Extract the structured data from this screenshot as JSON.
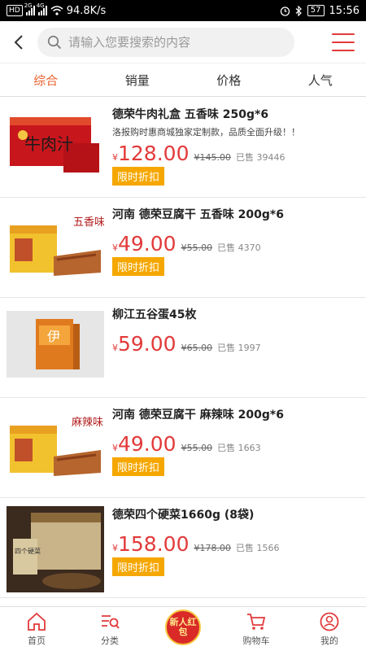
{
  "status_bar": {
    "hd": "HD",
    "net1": "2G",
    "net2": "4G",
    "speed": "94.8K/s",
    "battery": "57",
    "time": "15:56"
  },
  "header": {
    "search_placeholder": "请输入您要搜索的内容"
  },
  "tabs": [
    "综合",
    "销量",
    "价格",
    "人气"
  ],
  "currency": "¥",
  "products": [
    {
      "title": "德荣牛肉礼盒 五香味 250g*6",
      "subtitle": "洛报购时惠商城独家定制款，品质全面升级！！",
      "price": "128.00",
      "original": "¥145.00",
      "sold": "已售 39446",
      "badge": "限时折扣",
      "thumb_label": "牛肉汁"
    },
    {
      "title": "河南 德荣豆腐干 五香味 200g*6",
      "subtitle": "",
      "price": "49.00",
      "original": "¥55.00",
      "sold": "已售 4370",
      "badge": "限时折扣",
      "thumb_label": "五香味"
    },
    {
      "title": "柳江五谷蛋45枚",
      "subtitle": "",
      "price": "59.00",
      "original": "¥65.00",
      "sold": "已售 1997",
      "badge": "",
      "thumb_label": "伊"
    },
    {
      "title": "河南 德荣豆腐干 麻辣味 200g*6",
      "subtitle": "",
      "price": "49.00",
      "original": "¥55.00",
      "sold": "已售 1663",
      "badge": "限时折扣",
      "thumb_label": "麻辣味"
    },
    {
      "title": "德荣四个硬菜1660g (8袋)",
      "subtitle": "",
      "price": "158.00",
      "original": "¥178.00",
      "sold": "已售 1566",
      "badge": "限时折扣",
      "thumb_label": "四个硬菜"
    }
  ],
  "bottom_nav": {
    "home": "首页",
    "category": "分类",
    "red_packet": "新人红包",
    "cart": "购物车",
    "mine": "我的"
  }
}
